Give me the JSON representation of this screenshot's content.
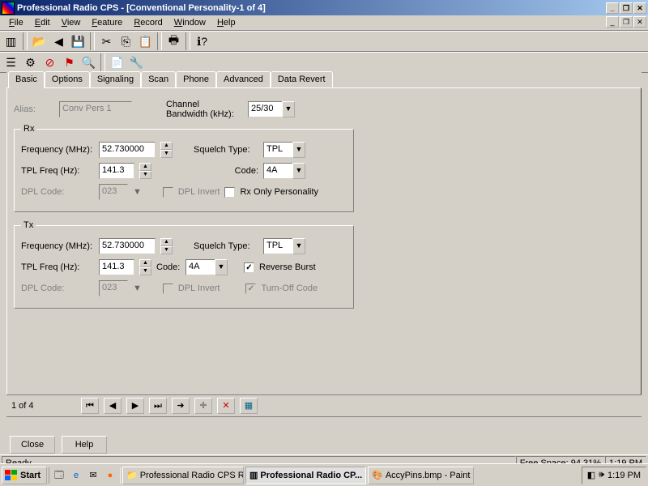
{
  "title": "Professional Radio CPS - [Conventional Personality-1 of 4]",
  "menu": [
    "File",
    "Edit",
    "View",
    "Feature",
    "Record",
    "Window",
    "Help"
  ],
  "tabs": [
    "Basic",
    "Options",
    "Signaling",
    "Scan",
    "Phone",
    "Advanced",
    "Data Revert"
  ],
  "alias_label": "Alias:",
  "alias_value": "Conv Pers 1",
  "cbw_label": "Channel\nBandwidth (kHz):",
  "cbw_value": "25/30",
  "rx": {
    "legend": "Rx",
    "freq_label": "Frequency (MHz):",
    "freq_value": "52.730000",
    "sq_label": "Squelch Type:",
    "sq_value": "TPL",
    "tpl_label": "TPL Freq (Hz):",
    "tpl_value": "141.3",
    "code_label": "Code:",
    "code_value": "4A",
    "dpl_label": "DPL Code:",
    "dpl_value": "023",
    "dpl_invert": "DPL Invert",
    "rx_only": "Rx Only Personality"
  },
  "tx": {
    "legend": "Tx",
    "freq_label": "Frequency (MHz):",
    "freq_value": "52.730000",
    "sq_label": "Squelch Type:",
    "sq_value": "TPL",
    "tpl_label": "TPL Freq (Hz):",
    "tpl_value": "141.3",
    "code_label": "Code:",
    "code_value": "4A",
    "rev_burst": "Reverse Burst",
    "dpl_label": "DPL Code:",
    "dpl_value": "023",
    "dpl_invert": "DPL Invert",
    "turnoff": "Turn-Off Code"
  },
  "nav_pos": "1 of 4",
  "close_btn": "Close",
  "help_btn": "Help",
  "status_ready": "Ready",
  "status_space": "Free Space:  94.31%",
  "status_time": "1:19 PM",
  "start": "Start",
  "task1": "Professional Radio CPS R...",
  "task2": "Professional Radio CP...",
  "task3": "AccyPins.bmp - Paint",
  "tray_time": "1:19 PM"
}
